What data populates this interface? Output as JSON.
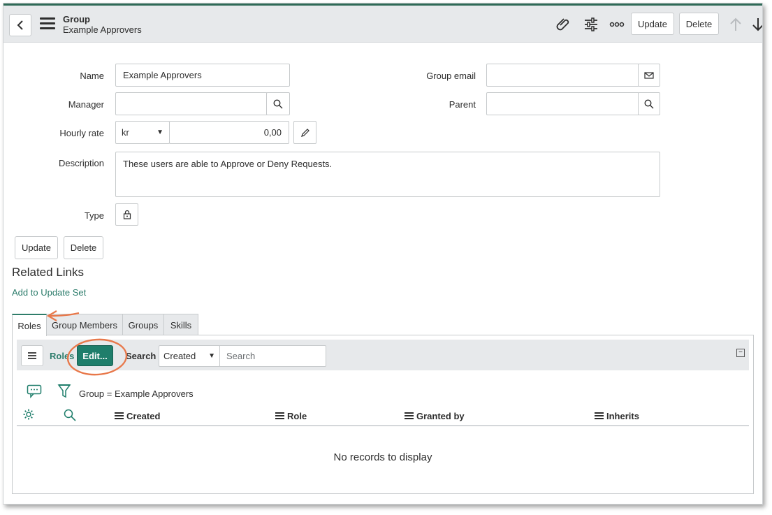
{
  "header": {
    "title": "Group",
    "subtitle": "Example Approvers",
    "update_label": "Update",
    "delete_label": "Delete"
  },
  "form": {
    "name_label": "Name",
    "name_value": "Example Approvers",
    "manager_label": "Manager",
    "manager_value": "",
    "hourly_rate_label": "Hourly rate",
    "currency_value": "kr",
    "hourly_rate_value": "0,00",
    "description_label": "Description",
    "description_value": "These users are able to Approve or Deny Requests.",
    "type_label": "Type",
    "group_email_label": "Group email",
    "group_email_value": "",
    "parent_label": "Parent",
    "parent_value": ""
  },
  "actions": {
    "update_label": "Update",
    "delete_label": "Delete"
  },
  "related_links": {
    "title": "Related Links",
    "add_to_update_set": "Add to Update Set"
  },
  "tabs": [
    {
      "label": "Roles",
      "active": true
    },
    {
      "label": "Group Members",
      "active": false
    },
    {
      "label": "Groups",
      "active": false
    },
    {
      "label": "Skills",
      "active": false
    }
  ],
  "list": {
    "title": "Roles",
    "edit_label": "Edit...",
    "search_label": "Search",
    "search_field_value": "Created",
    "search_placeholder": "Search",
    "filter_text": "Group = Example Approvers",
    "columns": [
      "Created",
      "Role",
      "Granted by",
      "Inherits"
    ],
    "empty_text": "No records to display"
  },
  "colors": {
    "accent": "#1f7e6b",
    "link": "#2c7c6b",
    "annotation": "#e8784a"
  }
}
